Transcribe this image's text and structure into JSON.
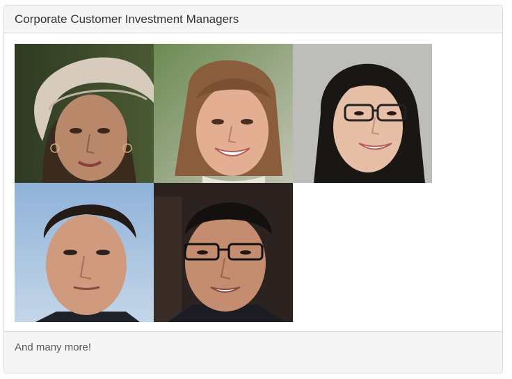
{
  "panel": {
    "title": "Corporate Customer Investment Managers",
    "footer_text": "And many more!"
  },
  "photos": [
    {
      "name": "manager-photo-1",
      "description_icon": "person-portrait-icon"
    },
    {
      "name": "manager-photo-2",
      "description_icon": "person-portrait-icon"
    },
    {
      "name": "manager-photo-3",
      "description_icon": "person-portrait-icon"
    },
    {
      "name": "manager-photo-4",
      "description_icon": "person-portrait-icon"
    },
    {
      "name": "manager-photo-5",
      "description_icon": "person-portrait-icon"
    }
  ],
  "colors": {
    "panel_bg": "#f5f5f5",
    "border": "#dcdcdc",
    "title_text": "#333333",
    "footer_text": "#555555"
  }
}
